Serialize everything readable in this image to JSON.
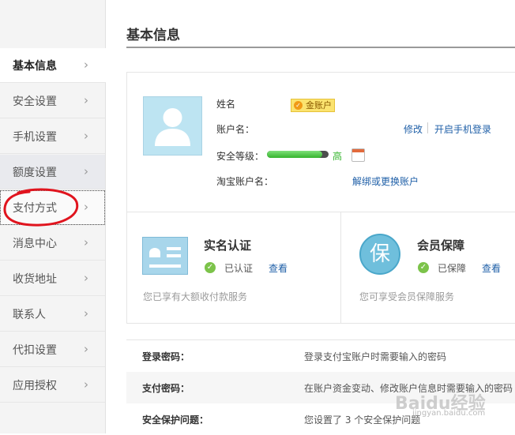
{
  "sidebar": {
    "items": [
      {
        "label": "基本信息"
      },
      {
        "label": "安全设置"
      },
      {
        "label": "手机设置"
      },
      {
        "label": "额度设置"
      },
      {
        "label": "支付方式"
      },
      {
        "label": "消息中心"
      },
      {
        "label": "收货地址"
      },
      {
        "label": "联系人"
      },
      {
        "label": "代扣设置"
      },
      {
        "label": "应用授权"
      }
    ],
    "chevron": "›"
  },
  "main": {
    "title": "基本信息",
    "profile": {
      "name_label": "姓名",
      "badge": "金账户",
      "account_label": "账户名：",
      "edit_link": "修改",
      "phone_login_link": "开启手机登录",
      "security_label": "安全等级：",
      "security_level_text": "高",
      "security_level_fraction": 0.9,
      "taobao_label": "淘宝账户名：",
      "unbind_link": "解绑或更换账户"
    },
    "verification": {
      "title": "实名认证",
      "status": "已认证",
      "view_link": "查看",
      "desc": "您已享有大额收付款服务"
    },
    "protection": {
      "title": "会员保障",
      "icon_char": "保",
      "status": "已保障",
      "view_link": "查看",
      "desc": "您可享受会员保障服务"
    },
    "security_rows": [
      {
        "key": "登录密码：",
        "value": "登录支付宝账户时需要输入的密码"
      },
      {
        "key": "支付密码：",
        "value": "在账户资金变动、修改账户信息时需要输入的密码"
      },
      {
        "key": "安全保护问题：",
        "value": "您设置了 3 个安全保护问题"
      }
    ]
  },
  "watermark": {
    "text": "Baidu经验",
    "sub": "jingyan.baidu.com"
  },
  "colors": {
    "link": "#2060a8",
    "security_green": "#35b42d",
    "badge_gold": "#fbe36f",
    "annotation_red": "#e0141e"
  }
}
